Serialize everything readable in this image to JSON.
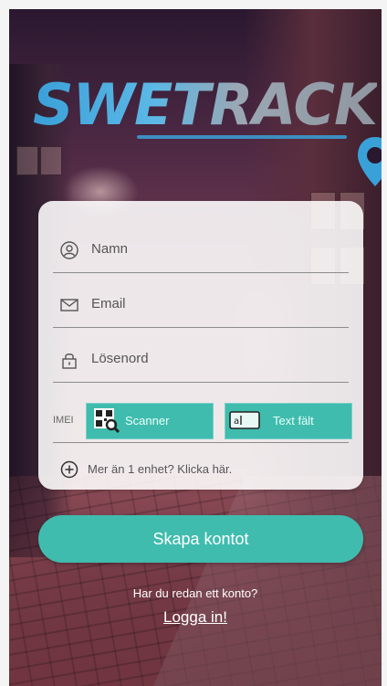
{
  "brand": {
    "logo_text": "SWETRACK",
    "accent": "#3fbcae",
    "logo_blue": "#3aa0d8"
  },
  "form": {
    "name_label": "Namn",
    "email_label": "Email",
    "password_label": "Lösenord",
    "imei_label": "IMEI",
    "scanner_label": "Scanner",
    "text_field_label": "Text fält",
    "more_devices": "Mer än 1 enhet? Klicka här."
  },
  "actions": {
    "create_account": "Skapa kontot",
    "have_account": "Har du redan ett konto?",
    "login": "Logga in!"
  },
  "icons": {
    "name": "user-icon",
    "email": "envelope-icon",
    "password": "lock-icon",
    "scanner": "qr-search-icon",
    "text_field": "keyboard-icon",
    "more": "plus-circle-icon"
  }
}
